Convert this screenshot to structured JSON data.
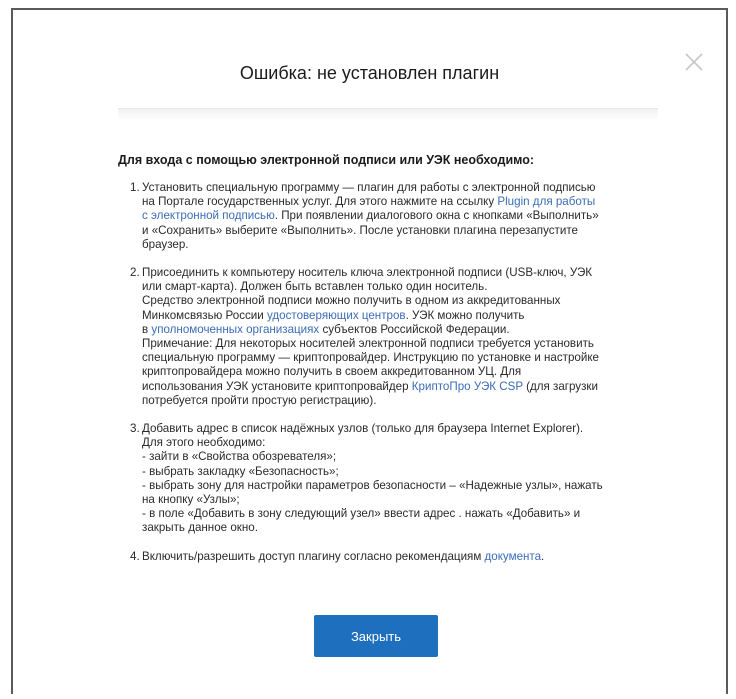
{
  "dialog": {
    "title": "Ошибка: не установлен плагин",
    "intro": "Для входа с помощью электронной подписи или УЭК необходимо:",
    "close_button_label": "Закрыть"
  },
  "steps": [
    {
      "num": "1.",
      "lines": [
        [
          "Установить специальную программу — плагин для работы с электронной подписью"
        ],
        [
          "на Портале государственных услуг. Для этого нажмите на ссылку ",
          {
            "link": "Plugin для работы"
          }
        ],
        [
          {
            "link": "с электронной подписью"
          },
          ". При появлении диалогового окна с кнопками «Выполнить»"
        ],
        [
          "и «Сохранить» выберите «Выполнить». После установки плагина перезапустите"
        ],
        [
          "браузер."
        ]
      ]
    },
    {
      "num": "2.",
      "lines": [
        [
          "Присоединить к компьютеру носитель ключа электронной подписи (USB-ключ, УЭК"
        ],
        [
          "или смарт-карта). Должен быть вставлен только один носитель."
        ],
        [
          "Средство электронной подписи можно получить в одном из аккредитованных"
        ],
        [
          "Минкомсвязью России ",
          {
            "link": "удостоверяющих центров"
          },
          ". УЭК можно получить"
        ],
        [
          "в ",
          {
            "link": "уполномоченных организациях"
          },
          " субъектов Российской Федерации."
        ],
        [
          "Примечание: Для некоторых носителей электронной подписи требуется установить"
        ],
        [
          "специальную программу — криптопровайдер. Инструкцию по установке и настройке"
        ],
        [
          "криптопровайдера можно получить в своем аккредитованном УЦ. Для"
        ],
        [
          "использования УЭК установите криптопровайдер ",
          {
            "link": "КриптоПро УЭК CSP"
          },
          " (для загрузки"
        ],
        [
          "потребуется пройти простую регистрацию)."
        ]
      ]
    },
    {
      "num": "3.",
      "lines": [
        [
          "Добавить адрес в список надёжных узлов (только для браузера Internet Explorer)."
        ],
        [
          "Для этого необходимо:"
        ],
        [
          "- зайти в «Свойства обозревателя»;"
        ],
        [
          "- выбрать закладку «Безопасность»;"
        ],
        [
          "- выбрать зону для настройки параметров безопасности – «Надежные узлы», нажать"
        ],
        [
          "на кнопку «Узлы»;"
        ],
        [
          "- в поле «Добавить в зону следующий узел» ввести адрес . нажать «Добавить» и"
        ],
        [
          "закрыть данное окно."
        ]
      ]
    },
    {
      "num": "4.",
      "lines": [
        [
          "Включить/разрешить доступ плагину согласно рекомендациям ",
          {
            "link": "документа"
          },
          "."
        ]
      ]
    }
  ],
  "colors": {
    "accent": "#1f6fbf",
    "link": "#3b6cb5"
  },
  "icons": {
    "close": "close-icon"
  }
}
